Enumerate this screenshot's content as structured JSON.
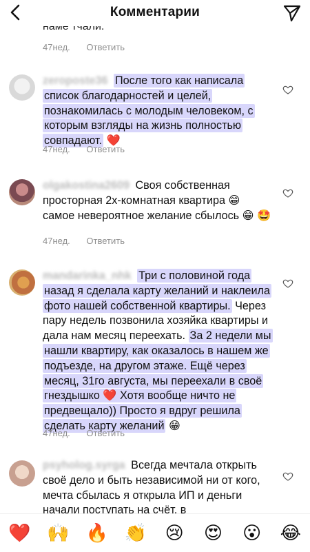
{
  "header": {
    "title": "Комментарии"
  },
  "cut_comment": {
    "text": "наме тчали.",
    "ago": "47нед.",
    "reply": "Ответить"
  },
  "comments": [
    {
      "username": "zeroposte36",
      "segments": [
        {
          "text": "После того как написала список благодарностей и целей, познакомилась с молодым человеком, с которым взгляды на жизнь полностью совпадают.",
          "hl": true
        },
        {
          "text": " ❤️",
          "hl": false
        }
      ],
      "ago": "47нед.",
      "reply": "Ответить"
    },
    {
      "username": "olgakostina2609",
      "segments": [
        {
          "text": "Своя собственная просторная  2х-комнатная квартира 😁 самое невероятное желание сбылось 😁 🤩",
          "hl": false
        }
      ],
      "ago": "47нед.",
      "reply": "Ответить"
    },
    {
      "username": "mandarinka_nhk",
      "segments": [
        {
          "text": "Три с половиной года назад я сделала карту желаний и наклеила фото нашей собственной квартиры.",
          "hl": true
        },
        {
          "text": " Через пару недель позвонила хозяйка квартиры и дала нам месяц переехать. ",
          "hl": false
        },
        {
          "text": "За 2 недели мы нашли квартиру, как оказалось в нашем же подъезде, на другом этаже. Ещё через месяц, 31го августа, мы переехали в своё гнездышко ❤️ Хотя вообще ничто не предвещало)) Просто я вдруг решила сделать карту желаний",
          "hl": true
        },
        {
          "text": " 😁",
          "hl": false
        }
      ],
      "ago": "47нед.",
      "reply": "Ответить"
    },
    {
      "username": "psyholog.syrga",
      "segments": [
        {
          "text": "Всегда мечтала открыть своё дело и быть независимой ни от кого, мечта сбылась я открыла ИП и деньги начали поступать на счёт, в",
          "hl": false
        }
      ],
      "ago": "",
      "reply": ""
    }
  ],
  "emoji_bar": [
    "❤️",
    "🙌",
    "🔥",
    "👏",
    "😢",
    "😍",
    "😮",
    "😂"
  ],
  "colors": {
    "highlight": "#d8d6fb",
    "meta": "#8e8e8e",
    "heart": "#e0245e"
  },
  "icons": {
    "back": "chevron-left-icon",
    "send": "paper-plane-icon",
    "like": "heart-outline-icon"
  }
}
